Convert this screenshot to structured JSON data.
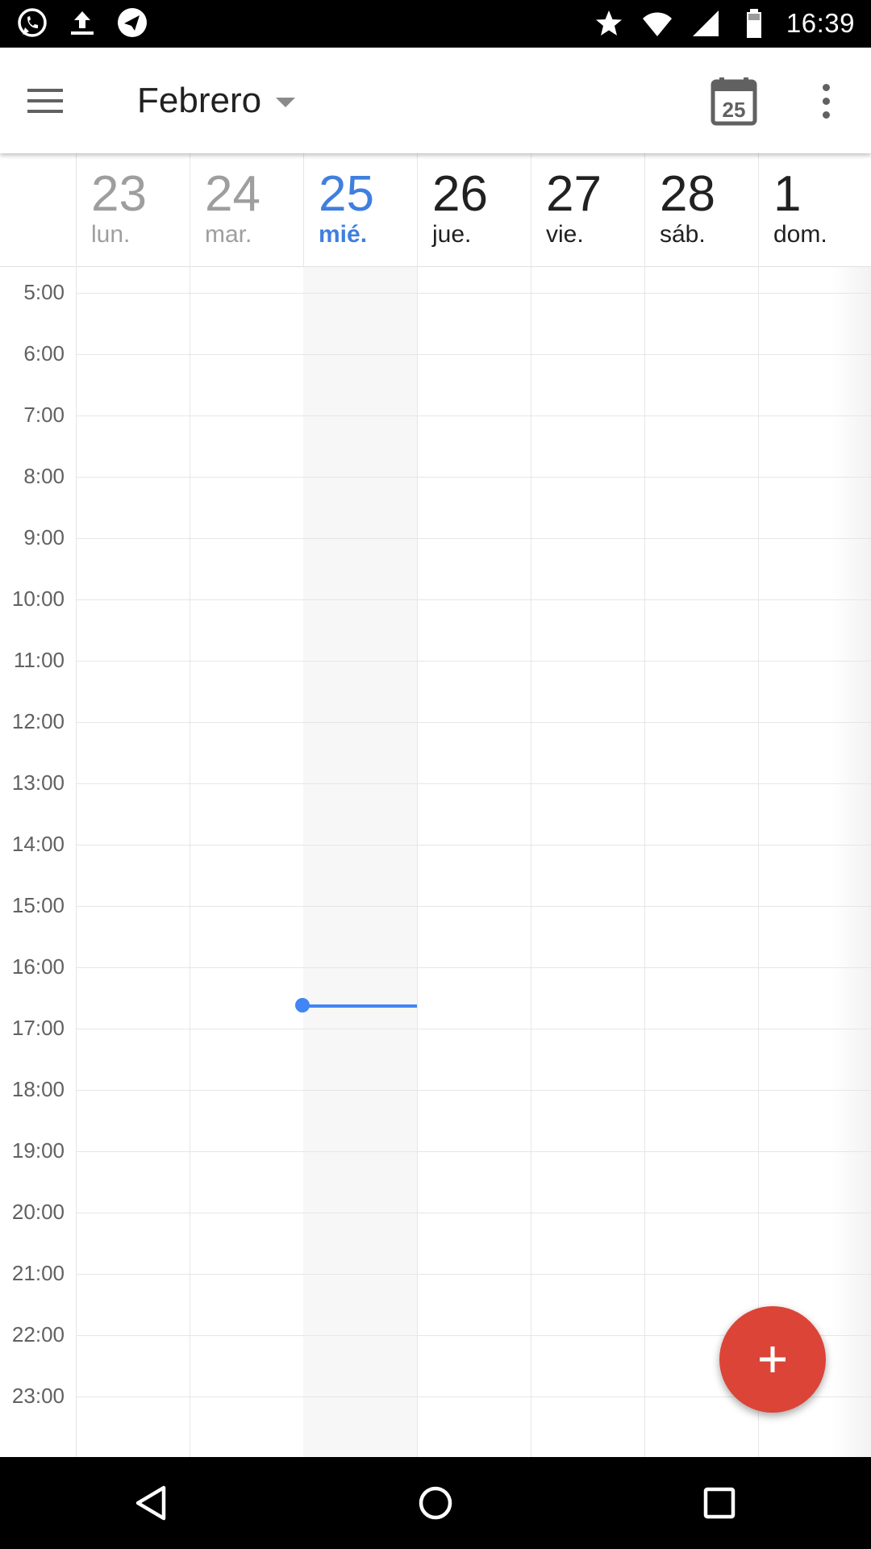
{
  "status_bar": {
    "time": "16:39",
    "left_icons": [
      "whatsapp-icon",
      "upload-icon",
      "telegram-icon"
    ],
    "right_icons": [
      "star-icon",
      "wifi-icon",
      "signal-icon",
      "battery-icon"
    ]
  },
  "app_bar": {
    "title": "Febrero",
    "today_icon_number": "25",
    "menu_icon": "hamburger-menu-icon",
    "overflow_icon": "overflow-menu-icon"
  },
  "days": [
    {
      "num": "23",
      "name": "lun.",
      "state": "past"
    },
    {
      "num": "24",
      "name": "mar.",
      "state": "past"
    },
    {
      "num": "25",
      "name": "mié.",
      "state": "today"
    },
    {
      "num": "26",
      "name": "jue.",
      "state": "future"
    },
    {
      "num": "27",
      "name": "vie.",
      "state": "future"
    },
    {
      "num": "28",
      "name": "sáb.",
      "state": "future"
    },
    {
      "num": "1",
      "name": "dom.",
      "state": "future"
    }
  ],
  "hours": [
    "5:00",
    "6:00",
    "7:00",
    "8:00",
    "9:00",
    "10:00",
    "11:00",
    "12:00",
    "13:00",
    "14:00",
    "15:00",
    "16:00",
    "17:00",
    "18:00",
    "19:00",
    "20:00",
    "21:00",
    "22:00",
    "23:00"
  ],
  "fab": {
    "icon": "add-icon"
  },
  "colors": {
    "accent": "#4285f4",
    "today_text": "#3f7fde",
    "fab": "#db4437",
    "past_text": "#9e9e9e",
    "future_text": "#212121"
  }
}
